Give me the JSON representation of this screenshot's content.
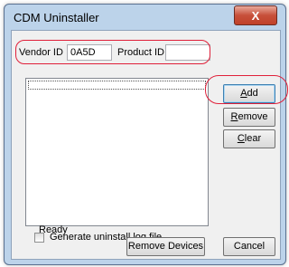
{
  "window": {
    "title": "CDM Uninstaller",
    "close_label": "X"
  },
  "form": {
    "vendor_id_label": "Vendor ID",
    "vendor_id_value": "0A5D",
    "product_id_label": "Product ID",
    "product_id_value": ""
  },
  "buttons": {
    "add_first": "A",
    "add_rest": "dd",
    "remove_first": "R",
    "remove_rest": "emove",
    "clear_first": "C",
    "clear_rest": "lear",
    "remove_devices": "Remove Devices",
    "cancel": "Cancel"
  },
  "options": {
    "log_checkbox_label": "Generate uninstall log file",
    "log_checked": false
  },
  "status": {
    "text": "Ready"
  },
  "annotation_color": "#e0203a"
}
